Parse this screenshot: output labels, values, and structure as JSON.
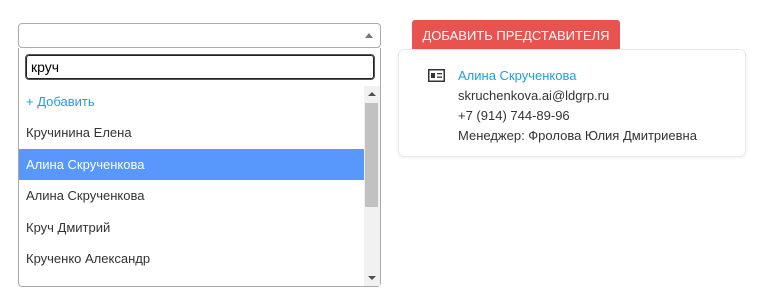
{
  "select": {
    "arrow_icon": "triangle-up-icon"
  },
  "dropdown": {
    "search_value": "круч",
    "options": [
      {
        "label": "+ Добавить",
        "type": "add"
      },
      {
        "label": "Кручинина Елена",
        "type": "normal"
      },
      {
        "label": "Алина Скрученкова",
        "type": "selected"
      },
      {
        "label": "Алина Скрученкова",
        "type": "normal"
      },
      {
        "label": "Круч Дмитрий",
        "type": "normal"
      },
      {
        "label": "Крученко Александр",
        "type": "normal"
      }
    ]
  },
  "add_representative_button": {
    "label": "Добавить представителя"
  },
  "contact_card": {
    "icon": "id-card-icon",
    "name": "Алина Скрученкова",
    "email": "skruchenkova.ai@ldgrp.ru",
    "phone": "+7 (914) 744-89-96",
    "manager": "Менеджер: Фролова Юлия Дмитриевна"
  },
  "colors": {
    "accent_blue": "#1e9fe3",
    "selected_bg": "#5897fb",
    "button_red": "#e8534f"
  }
}
